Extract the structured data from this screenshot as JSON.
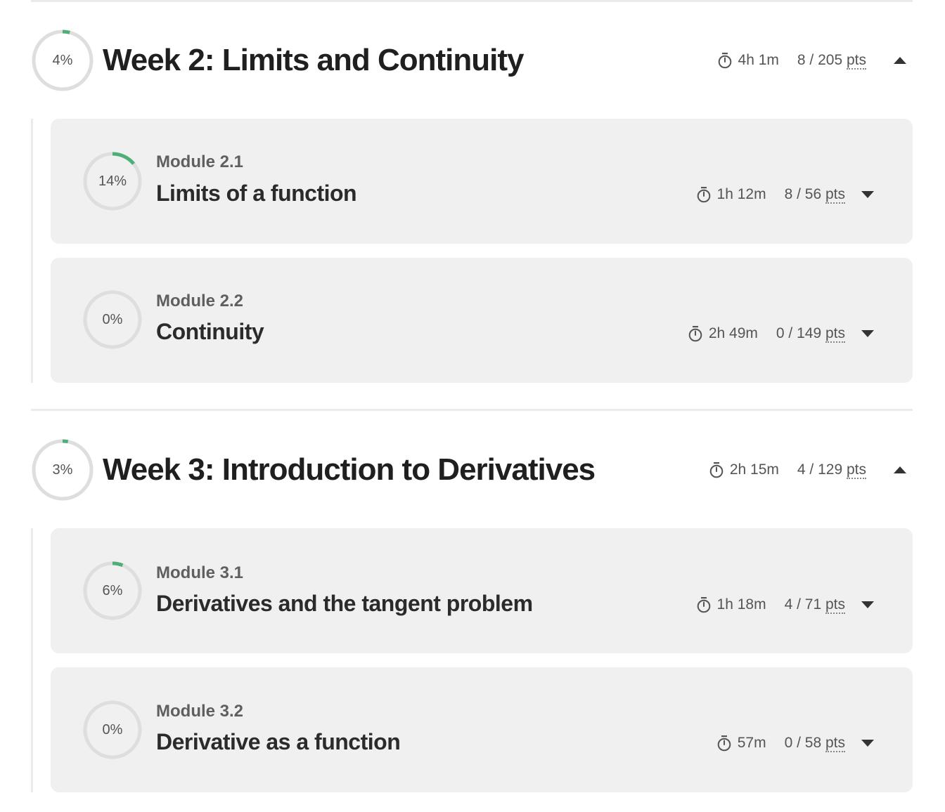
{
  "colors": {
    "progress": "#4caf78",
    "track": "#dedede",
    "card": "#f0f0f0"
  },
  "weeks": [
    {
      "title": "Week 2: Limits and Continuity",
      "progress_label": "4%",
      "progress": 0.04,
      "time": "4h 1m",
      "points": "8 / 205",
      "points_unit": "pts",
      "toggle_icon": "caret-up-icon",
      "modules": [
        {
          "kicker": "Module 2.1",
          "title": "Limits of a function",
          "progress_label": "14%",
          "progress": 0.14,
          "time": "1h 12m",
          "points": "8 / 56",
          "points_unit": "pts",
          "toggle_icon": "caret-down-icon"
        },
        {
          "kicker": "Module 2.2",
          "title": "Continuity",
          "progress_label": "0%",
          "progress": 0,
          "time": "2h 49m",
          "points": "0 / 149",
          "points_unit": "pts",
          "toggle_icon": "caret-down-icon"
        }
      ]
    },
    {
      "title": "Week 3: Introduction to Derivatives",
      "progress_label": "3%",
      "progress": 0.03,
      "time": "2h 15m",
      "points": "4 / 129",
      "points_unit": "pts",
      "toggle_icon": "caret-up-icon",
      "modules": [
        {
          "kicker": "Module 3.1",
          "title": "Derivatives and the tangent problem",
          "progress_label": "6%",
          "progress": 0.06,
          "time": "1h 18m",
          "points": "4 / 71",
          "points_unit": "pts",
          "toggle_icon": "caret-down-icon"
        },
        {
          "kicker": "Module 3.2",
          "title": "Derivative as a function",
          "progress_label": "0%",
          "progress": 0,
          "time": "57m",
          "points": "0 / 58",
          "points_unit": "pts",
          "toggle_icon": "caret-down-icon"
        }
      ]
    }
  ]
}
